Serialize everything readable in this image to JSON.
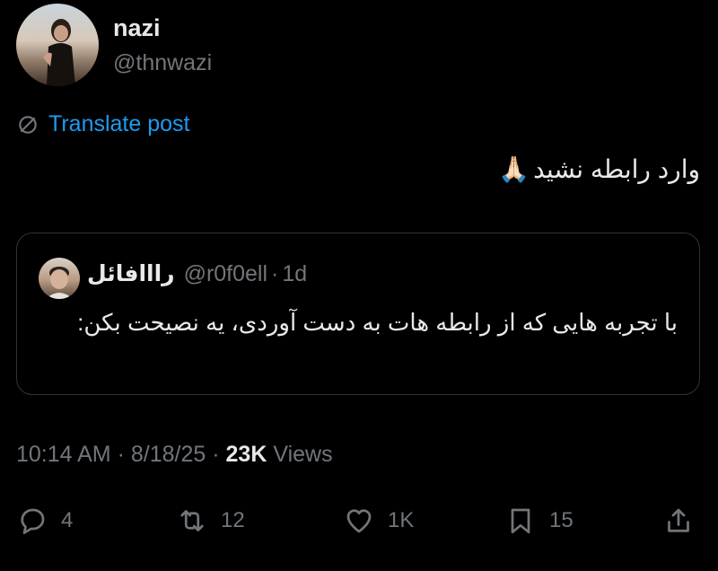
{
  "author": {
    "display_name": "nazi",
    "handle": "@thnwazi"
  },
  "translate_label": "Translate post",
  "post_text": "وارد رابطه نشید",
  "post_emoji": "🙏🏻",
  "quoted": {
    "name": "رااافائل",
    "handle": "@r0f0ell",
    "separator": "·",
    "age": "1d",
    "text": "با تجربه هایی که از رابطه هات به دست آوردی، یه نصیحت بکن:"
  },
  "timestamp": {
    "time": "10:14 AM",
    "sep1": "·",
    "date": "8/18/25",
    "sep2": "·",
    "views_count": "23K",
    "views_label": "Views"
  },
  "actions": {
    "replies": "4",
    "reposts": "12",
    "likes": "1K",
    "bookmarks": "15"
  },
  "colors": {
    "accent": "#1d9bf0",
    "muted": "#71767b",
    "text": "#e7e9ea",
    "border": "#2f3336"
  }
}
